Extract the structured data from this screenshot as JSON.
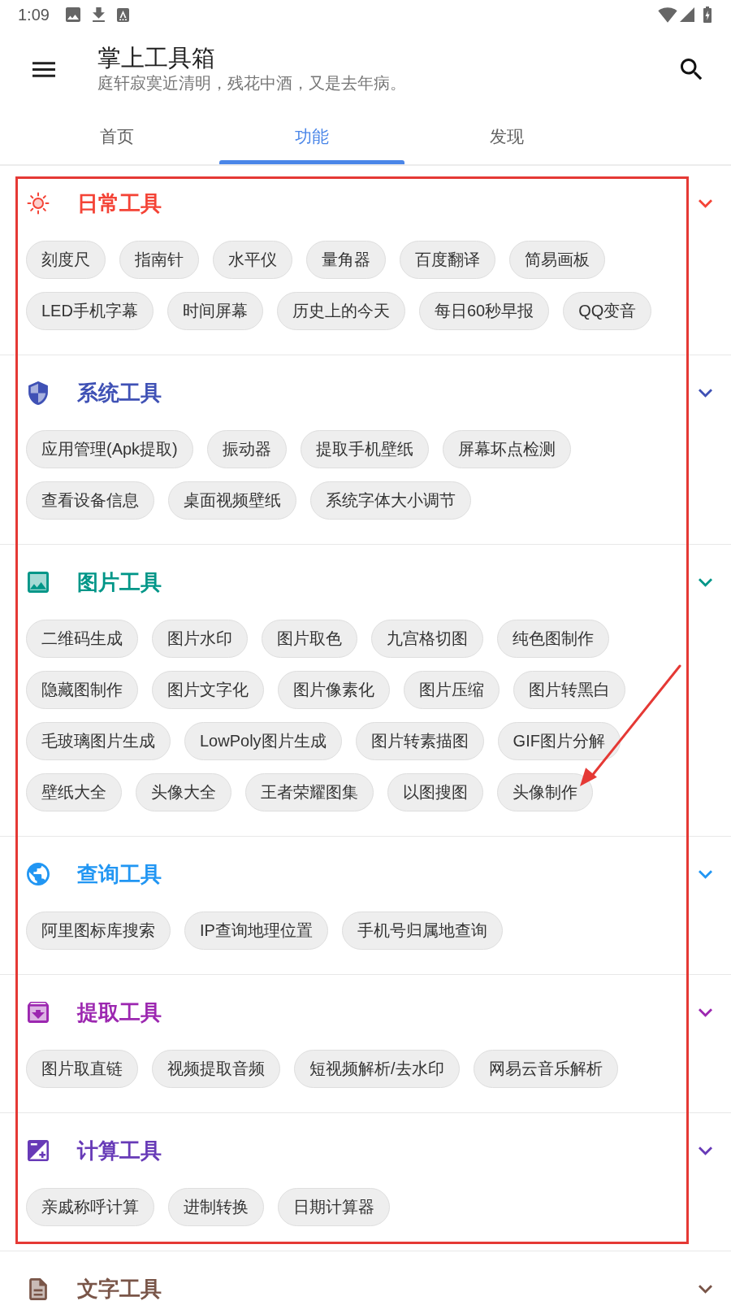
{
  "status_bar": {
    "time": "1:09"
  },
  "app_bar": {
    "title": "掌上工具箱",
    "subtitle": "庭轩寂寞近清明，残花中酒，又是去年病。"
  },
  "tabs": [
    {
      "label": "首页",
      "selected": false
    },
    {
      "label": "功能",
      "selected": true
    },
    {
      "label": "发现",
      "selected": false
    }
  ],
  "sections": [
    {
      "title": "日常工具",
      "color": "#f44336",
      "chips": [
        "刻度尺",
        "指南针",
        "水平仪",
        "量角器",
        "百度翻译",
        "简易画板",
        "LED手机字幕",
        "时间屏幕",
        "历史上的今天",
        "每日60秒早报",
        "QQ变音"
      ]
    },
    {
      "title": "系统工具",
      "color": "#3f51b5",
      "chips": [
        "应用管理(Apk提取)",
        "振动器",
        "提取手机壁纸",
        "屏幕坏点检测",
        "查看设备信息",
        "桌面视频壁纸",
        "系统字体大小调节"
      ]
    },
    {
      "title": "图片工具",
      "color": "#009688",
      "chips": [
        "二维码生成",
        "图片水印",
        "图片取色",
        "九宫格切图",
        "纯色图制作",
        "隐藏图制作",
        "图片文字化",
        "图片像素化",
        "图片压缩",
        "图片转黑白",
        "毛玻璃图片生成",
        "LowPoly图片生成",
        "图片转素描图",
        "GIF图片分解",
        "壁纸大全",
        "头像大全",
        "王者荣耀图集",
        "以图搜图",
        "头像制作"
      ]
    },
    {
      "title": "查询工具",
      "color": "#2196f3",
      "chips": [
        "阿里图标库搜索",
        "IP查询地理位置",
        "手机号归属地查询"
      ]
    },
    {
      "title": "提取工具",
      "color": "#9c27b0",
      "chips": [
        "图片取直链",
        "视频提取音频",
        "短视频解析/去水印",
        "网易云音乐解析"
      ]
    },
    {
      "title": "计算工具",
      "color": "#673ab7",
      "chips": [
        "亲戚称呼计算",
        "进制转换",
        "日期计算器"
      ]
    },
    {
      "title": "文字工具",
      "color": "#795548"
    }
  ],
  "annotation": {
    "frame": true,
    "arrow": true
  }
}
